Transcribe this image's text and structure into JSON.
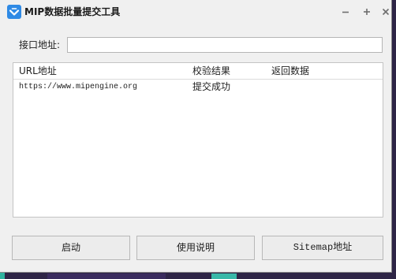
{
  "window": {
    "title": "MIP数据批量提交工具",
    "app_icon": "mip-logo-icon",
    "controls": [
      "minimize-icon",
      "maximize-icon",
      "close-icon"
    ]
  },
  "form": {
    "api_label": "接口地址:",
    "api_value": ""
  },
  "table": {
    "columns": [
      "URL地址",
      "校验结果",
      "返回数据"
    ],
    "rows": [
      {
        "url": "https://www.mipengine.org",
        "result": "提交成功"
      }
    ]
  },
  "buttons": {
    "start": "启动",
    "help": "使用说明",
    "sitemap": "Sitemap地址"
  },
  "colors": {
    "window_bg": "#f0f0f0",
    "accent": "#2f8ae5",
    "desktop": "#2e2546"
  }
}
